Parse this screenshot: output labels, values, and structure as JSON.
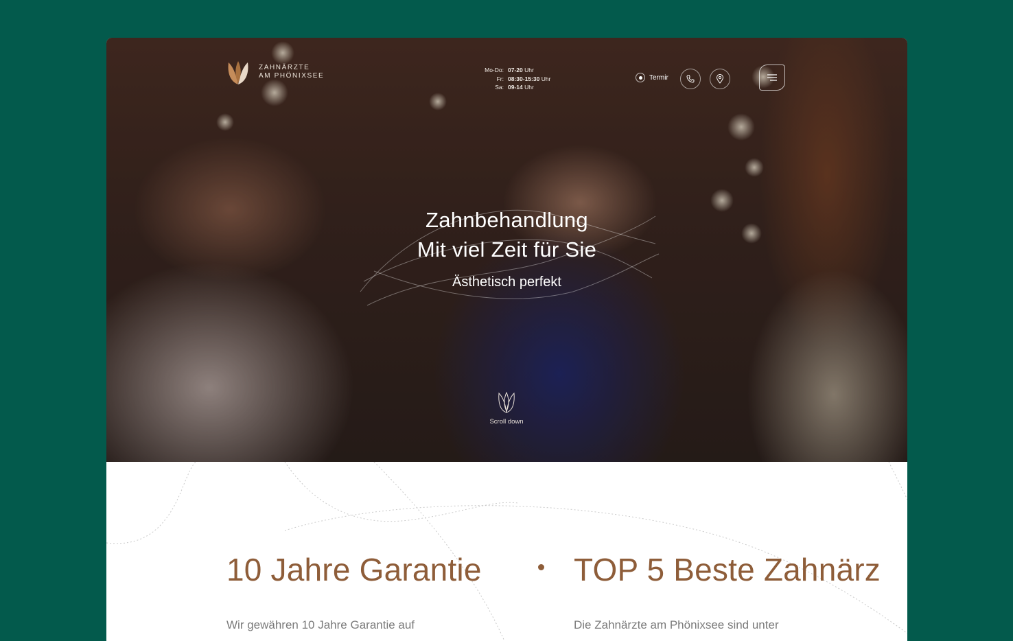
{
  "brand": {
    "line1": "ZAHNÄRZTE",
    "line2": "AM PHÖNIXSEE"
  },
  "hours": [
    {
      "day": "Mo-Do:",
      "time": "07-20",
      "unit": "Uhr"
    },
    {
      "day": "Fr:",
      "time": "08:30-15:30",
      "unit": "Uhr"
    },
    {
      "day": "Sa:",
      "time": "09-14",
      "unit": "Uhr"
    }
  ],
  "nav": {
    "termin_label": "Termir",
    "phone_icon": "phone-icon",
    "location_icon": "location-pin-icon",
    "menu_icon": "hamburger-menu-icon"
  },
  "hero": {
    "title_line1": "Zahnbehandlung",
    "title_line2": "Mit viel Zeit für Sie",
    "subtitle": "Ästhetisch perfekt",
    "scroll_label": "Scroll down"
  },
  "features": [
    {
      "title": "10 Jahre Garantie",
      "text": "Wir gewähren 10 Jahre Garantie auf"
    },
    {
      "title": "TOP 5 Beste Zahnärz",
      "text": "Die Zahnärzte am Phönixsee sind unter"
    }
  ],
  "colors": {
    "background": "#035a4c",
    "accent": "#8e5d39",
    "body_text": "#7b7b7b"
  }
}
